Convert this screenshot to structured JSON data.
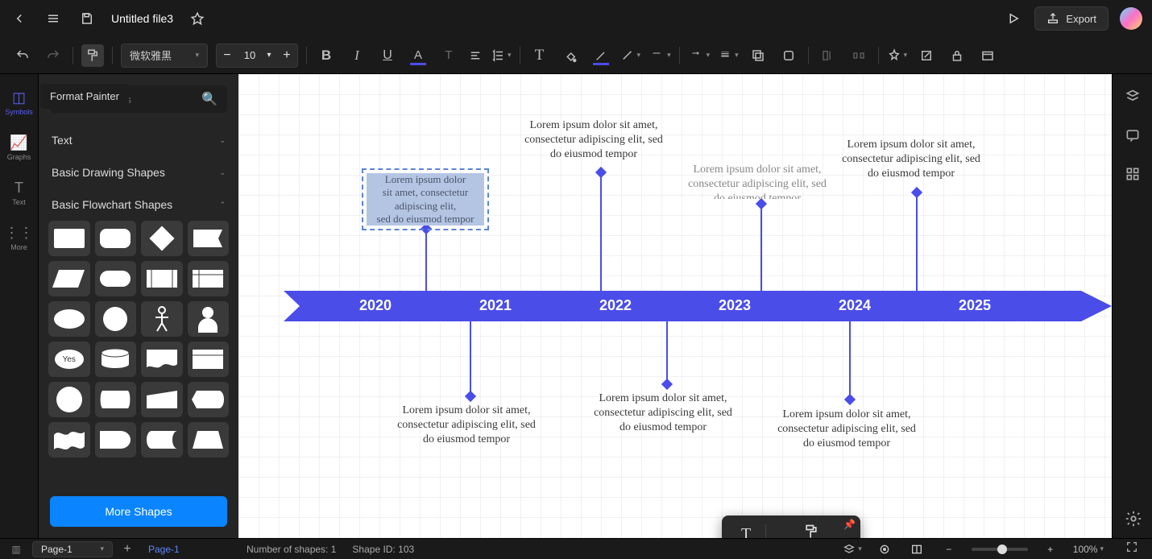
{
  "header": {
    "title": "Untitled file3",
    "export_label": "Export"
  },
  "toolbar": {
    "font": "微软雅黑",
    "font_size": "10"
  },
  "tooltip": "Format Painter",
  "leftRail": {
    "symbols": "Symbols",
    "graphs": "Graphs",
    "text": "Text",
    "more": "More"
  },
  "shapes": {
    "search_placeholder": "Search Shapes",
    "cat_text": "Text",
    "cat_basic": "Basic Drawing Shapes",
    "cat_flow": "Basic Flowchart Shapes",
    "more": "More Shapes",
    "yes_label": "Yes"
  },
  "timeline": {
    "years": [
      "2020",
      "2021",
      "2022",
      "2023",
      "2024",
      "2025"
    ],
    "lorem": "Lorem ipsum dolor sit amet, consectetur adipiscing elit, sed do eiusmod tempor",
    "selected_lines": [
      "Lorem ipsum dolor",
      "sit amet, consectetur",
      "adipiscing elit,",
      "sed do eiusmod tempor"
    ]
  },
  "floatToolbar": {
    "text": "Text",
    "painter": "Format Painter"
  },
  "status": {
    "shapes_label": "Number of shapes:",
    "shapes_count": "1",
    "shapeid_label": "Shape ID:",
    "shapeid": "103",
    "zoom": "100%"
  },
  "pages": {
    "current": "Page-1",
    "tab": "Page-1"
  },
  "colors": {
    "accent": "#4a4de8"
  }
}
